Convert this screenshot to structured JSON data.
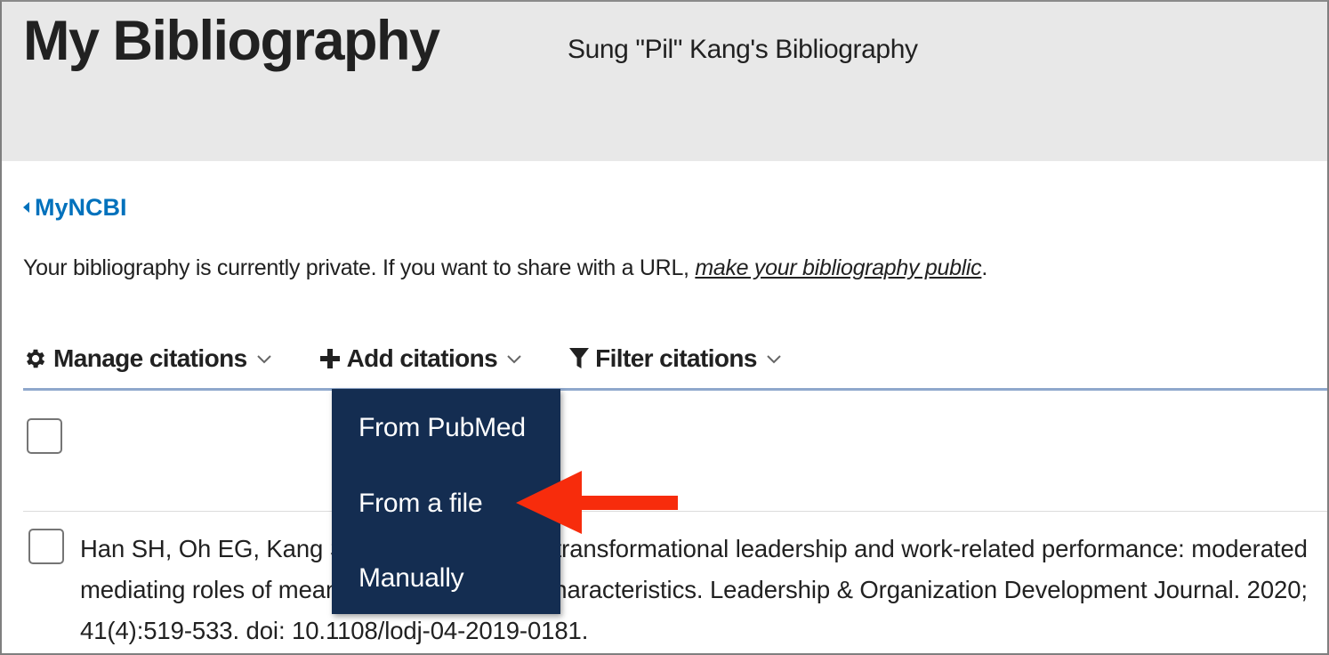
{
  "header": {
    "title": "My Bibliography",
    "subtitle": "Sung \"Pil\" Kang's Bibliography"
  },
  "back_link": {
    "icon": "caret-left-icon",
    "label": "MyNCBI"
  },
  "privacy_notice": {
    "text": "Your bibliography is currently private. If you want to share with a URL, ",
    "link_label": "make your bibliography public",
    "suffix": "."
  },
  "toolbar": {
    "items": [
      {
        "icon": "gear-icon",
        "label": "Manage citations",
        "chevron": "chevron-down-icon"
      },
      {
        "icon": "plus-icon",
        "label": "Add citations",
        "chevron": "chevron-down-icon"
      },
      {
        "icon": "filter-icon",
        "label": "Filter citations",
        "chevron": "chevron-down-icon"
      }
    ]
  },
  "add_citations_menu": {
    "open": true,
    "items": [
      {
        "label": "From PubMed"
      },
      {
        "label": "From a file",
        "highlighted_by_arrow": true
      },
      {
        "label": "Manually"
      }
    ]
  },
  "annotation": {
    "type": "arrow",
    "color": "#f72c0c",
    "points_to": "From a file"
  },
  "citations": [
    {
      "checked": false,
      "text": "Han SH, Oh EG, Kang SP. Linking between transformational leadership and work-related performance: moderated mediating roles of meaningfulness and job characteristics. Leadership & Organization Development Journal. 2020; 41(4):519-533. doi: 10.1108/lodj-04-2019-0181."
    }
  ],
  "select_all": {
    "checked": false
  },
  "colors": {
    "header_bg": "#e8e8e8",
    "link_blue": "#0071bc",
    "menu_bg": "#142d51",
    "toolbar_rule": "#8fa8cc",
    "arrow_red": "#f72c0c"
  }
}
